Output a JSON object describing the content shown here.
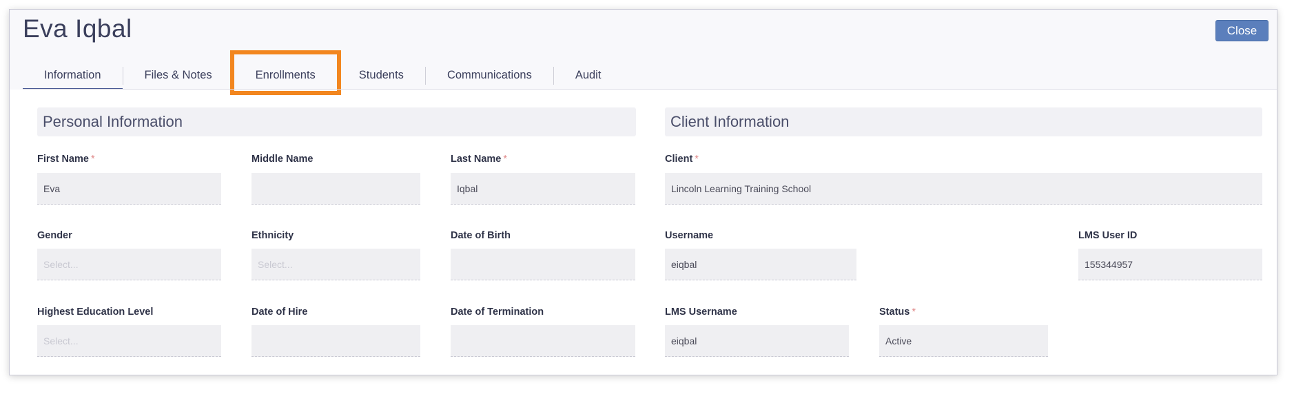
{
  "header": {
    "title": "Eva Iqbal",
    "close_label": "Close"
  },
  "tabs": [
    {
      "label": "Information",
      "active": true
    },
    {
      "label": "Files & Notes"
    },
    {
      "label": "Enrollments",
      "highlighted": true
    },
    {
      "label": "Students"
    },
    {
      "label": "Communications"
    },
    {
      "label": "Audit"
    }
  ],
  "personal": {
    "heading": "Personal Information",
    "first_name": {
      "label": "First Name",
      "required_mark": "*",
      "value": "Eva"
    },
    "middle_name": {
      "label": "Middle Name",
      "value": ""
    },
    "last_name": {
      "label": "Last Name",
      "required_mark": "*",
      "value": "Iqbal"
    },
    "gender": {
      "label": "Gender",
      "placeholder": "Select..."
    },
    "ethnicity": {
      "label": "Ethnicity",
      "placeholder": "Select..."
    },
    "date_of_birth": {
      "label": "Date of Birth",
      "value": ""
    },
    "education": {
      "label": "Highest Education Level",
      "placeholder": "Select..."
    },
    "date_of_hire": {
      "label": "Date of Hire",
      "value": ""
    },
    "date_of_termination": {
      "label": "Date of Termination",
      "value": ""
    }
  },
  "client": {
    "heading": "Client Information",
    "client": {
      "label": "Client",
      "required_mark": "*",
      "value": "Lincoln Learning Training School"
    },
    "username": {
      "label": "Username",
      "value": "eiqbal"
    },
    "lms_user_id": {
      "label": "LMS User ID",
      "value": "155344957"
    },
    "lms_username": {
      "label": "LMS Username",
      "value": "eiqbal"
    },
    "status": {
      "label": "Status",
      "required_mark": "*",
      "value": "Active"
    }
  },
  "colors": {
    "accent": "#5b7fbc",
    "highlight": "#f2861f",
    "active_tab_underline": "#4a5a94",
    "required": "#e08a8a"
  }
}
